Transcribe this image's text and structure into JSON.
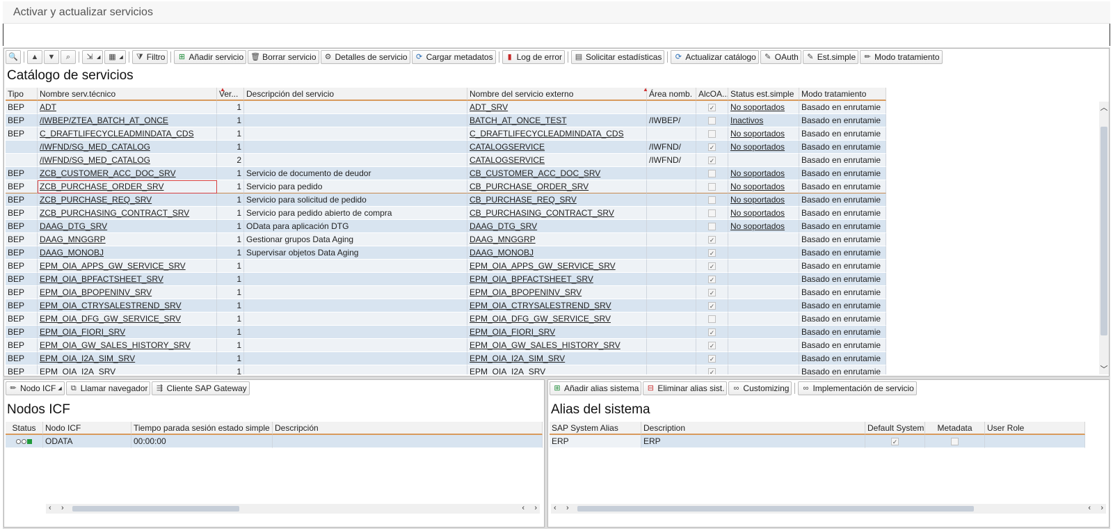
{
  "window": {
    "title": "Activar y actualizar servicios"
  },
  "catalog": {
    "title": "Catálogo de servicios",
    "toolbar": {
      "filter": "Filtro",
      "add_service": "Añadir servicio",
      "delete_service": "Borrar servicio",
      "service_details": "Detalles de servicio",
      "load_metadata": "Cargar metadatos",
      "error_log": "Log de error",
      "request_stats": "Solicitar estadísticas",
      "update_catalog": "Actualizar catálogo",
      "oauth": "OAuth",
      "est_simple": "Est.simple",
      "processing_mode": "Modo tratamiento"
    },
    "columns": {
      "type": "Tipo",
      "tech_name": "Nombre serv.técnico",
      "version": "Ver...",
      "description": "Descripción del servicio",
      "ext_name": "Nombre del servicio externo",
      "namespace": "Área nomb.",
      "alcoa": "AlcOA...",
      "status": "Status est.simple",
      "mode": "Modo tratamiento"
    },
    "rows": [
      {
        "type": "BEP",
        "tech": "ADT",
        "ver": "1",
        "desc": "",
        "ext": "ADT_SRV",
        "ns": "",
        "chk": true,
        "status": "No soportados",
        "mode": "Basado en enrutamie"
      },
      {
        "type": "BEP",
        "tech": "/IWBEP/ZTEA_BATCH_AT_ONCE",
        "ver": "1",
        "desc": "",
        "ext": "BATCH_AT_ONCE_TEST",
        "ns": "/IWBEP/",
        "chk": false,
        "status": "Inactivos",
        "mode": "Basado en enrutamie"
      },
      {
        "type": "BEP",
        "tech": "C_DRAFTLIFECYCLEADMINDATA_CDS",
        "ver": "1",
        "desc": "",
        "ext": "C_DRAFTLIFECYCLEADMINDATA_CDS",
        "ns": "",
        "chk": false,
        "status": "No soportados",
        "mode": "Basado en enrutamie"
      },
      {
        "type": "",
        "tech": "/IWFND/SG_MED_CATALOG",
        "ver": "1",
        "desc": "",
        "ext": "CATALOGSERVICE",
        "ns": "/IWFND/",
        "chk": true,
        "status": "No soportados",
        "mode": "Basado en enrutamie"
      },
      {
        "type": "",
        "tech": "/IWFND/SG_MED_CATALOG",
        "ver": "2",
        "desc": "",
        "ext": "CATALOGSERVICE",
        "ns": "/IWFND/",
        "chk": true,
        "status": "",
        "mode": "Basado en enrutamie"
      },
      {
        "type": "BEP",
        "tech": "ZCB_CUSTOMER_ACC_DOC_SRV",
        "ver": "1",
        "desc": "Servicio de documento de deudor",
        "ext": "CB_CUSTOMER_ACC_DOC_SRV",
        "ns": "",
        "chk": false,
        "status": "No soportados",
        "mode": "Basado en enrutamie"
      },
      {
        "type": "BEP",
        "tech": "ZCB_PURCHASE_ORDER_SRV",
        "ver": "1",
        "desc": "Servicio para pedido",
        "ext": "CB_PURCHASE_ORDER_SRV",
        "ns": "",
        "chk": false,
        "status": "No soportados",
        "mode": "Basado en enrutamie"
      },
      {
        "type": "BEP",
        "tech": "ZCB_PURCHASE_REQ_SRV",
        "ver": "1",
        "desc": "Servicio para solicitud de pedido",
        "ext": "CB_PURCHASE_REQ_SRV",
        "ns": "",
        "chk": false,
        "status": "No soportados",
        "mode": "Basado en enrutamie"
      },
      {
        "type": "BEP",
        "tech": "ZCB_PURCHASING_CONTRACT_SRV",
        "ver": "1",
        "desc": "Servicio para pedido abierto de compra",
        "ext": "CB_PURCHASING_CONTRACT_SRV",
        "ns": "",
        "chk": false,
        "status": "No soportados",
        "mode": "Basado en enrutamie"
      },
      {
        "type": "BEP",
        "tech": "DAAG_DTG_SRV",
        "ver": "1",
        "desc": "OData para aplicación DTG",
        "ext": "DAAG_DTG_SRV",
        "ns": "",
        "chk": false,
        "status": "No soportados",
        "mode": "Basado en enrutamie"
      },
      {
        "type": "BEP",
        "tech": "DAAG_MNGGRP",
        "ver": "1",
        "desc": "Gestionar grupos Data Aging",
        "ext": "DAAG_MNGGRP",
        "ns": "",
        "chk": true,
        "status": "",
        "mode": "Basado en enrutamie"
      },
      {
        "type": "BEP",
        "tech": "DAAG_MONOBJ",
        "ver": "1",
        "desc": "Supervisar objetos Data Aging",
        "ext": "DAAG_MONOBJ",
        "ns": "",
        "chk": true,
        "status": "",
        "mode": "Basado en enrutamie"
      },
      {
        "type": "BEP",
        "tech": "EPM_OIA_APPS_GW_SERVICE_SRV",
        "ver": "1",
        "desc": "",
        "ext": "EPM_OIA_APPS_GW_SERVICE_SRV",
        "ns": "",
        "chk": true,
        "status": "",
        "mode": "Basado en enrutamie"
      },
      {
        "type": "BEP",
        "tech": "EPM_OIA_BPFACTSHEET_SRV",
        "ver": "1",
        "desc": "",
        "ext": "EPM_OIA_BPFACTSHEET_SRV",
        "ns": "",
        "chk": true,
        "status": "",
        "mode": "Basado en enrutamie"
      },
      {
        "type": "BEP",
        "tech": "EPM_OIA_BPOPENINV_SRV",
        "ver": "1",
        "desc": "",
        "ext": "EPM_OIA_BPOPENINV_SRV",
        "ns": "",
        "chk": true,
        "status": "",
        "mode": "Basado en enrutamie"
      },
      {
        "type": "BEP",
        "tech": "EPM_OIA_CTRYSALESTREND_SRV",
        "ver": "1",
        "desc": "",
        "ext": "EPM_OIA_CTRYSALESTREND_SRV",
        "ns": "",
        "chk": true,
        "status": "",
        "mode": "Basado en enrutamie"
      },
      {
        "type": "BEP",
        "tech": "EPM_OIA_DFG_GW_SERVICE_SRV",
        "ver": "1",
        "desc": "",
        "ext": "EPM_OIA_DFG_GW_SERVICE_SRV",
        "ns": "",
        "chk": false,
        "status": "",
        "mode": "Basado en enrutamie"
      },
      {
        "type": "BEP",
        "tech": "EPM_OIA_FIORI_SRV",
        "ver": "1",
        "desc": "",
        "ext": "EPM_OIA_FIORI_SRV",
        "ns": "",
        "chk": true,
        "status": "",
        "mode": "Basado en enrutamie"
      },
      {
        "type": "BEP",
        "tech": "EPM_OIA_GW_SALES_HISTORY_SRV",
        "ver": "1",
        "desc": "",
        "ext": "EPM_OIA_GW_SALES_HISTORY_SRV",
        "ns": "",
        "chk": true,
        "status": "",
        "mode": "Basado en enrutamie"
      },
      {
        "type": "BEP",
        "tech": "EPM_OIA_I2A_SIM_SRV",
        "ver": "1",
        "desc": "",
        "ext": "EPM_OIA_I2A_SIM_SRV",
        "ns": "",
        "chk": true,
        "status": "",
        "mode": "Basado en enrutamie"
      },
      {
        "type": "BEP",
        "tech": "EPM_OIA_I2A_SRV",
        "ver": "1",
        "desc": "",
        "ext": "EPM_OIA_I2A_SRV",
        "ns": "",
        "chk": true,
        "status": "",
        "mode": "Basado en enrutamie"
      }
    ]
  },
  "icf": {
    "title": "Nodos ICF",
    "toolbar": {
      "icf_node": "Nodo ICF",
      "call_browser": "Llamar navegador",
      "gateway_client": "Cliente SAP Gateway"
    },
    "columns": {
      "status": "Status",
      "node": "Nodo ICF",
      "timeout": "Tiempo parada sesión estado simple",
      "description": "Descripción"
    },
    "rows": [
      {
        "node": "ODATA",
        "timeout": "00:00:00",
        "description": ""
      }
    ]
  },
  "alias": {
    "title": "Alias del sistema",
    "toolbar": {
      "add_alias": "Añadir alias sistema",
      "delete_alias": "Eliminar alias sist.",
      "customizing": "Customizing",
      "service_impl": "Implementación de servicio"
    },
    "columns": {
      "alias": "SAP System Alias",
      "description": "Description",
      "default": "Default System",
      "metadata": "Metadata",
      "role": "User Role"
    },
    "rows": [
      {
        "alias": "ERP",
        "description": "ERP",
        "default": true,
        "metadata": false,
        "role": ""
      }
    ]
  }
}
